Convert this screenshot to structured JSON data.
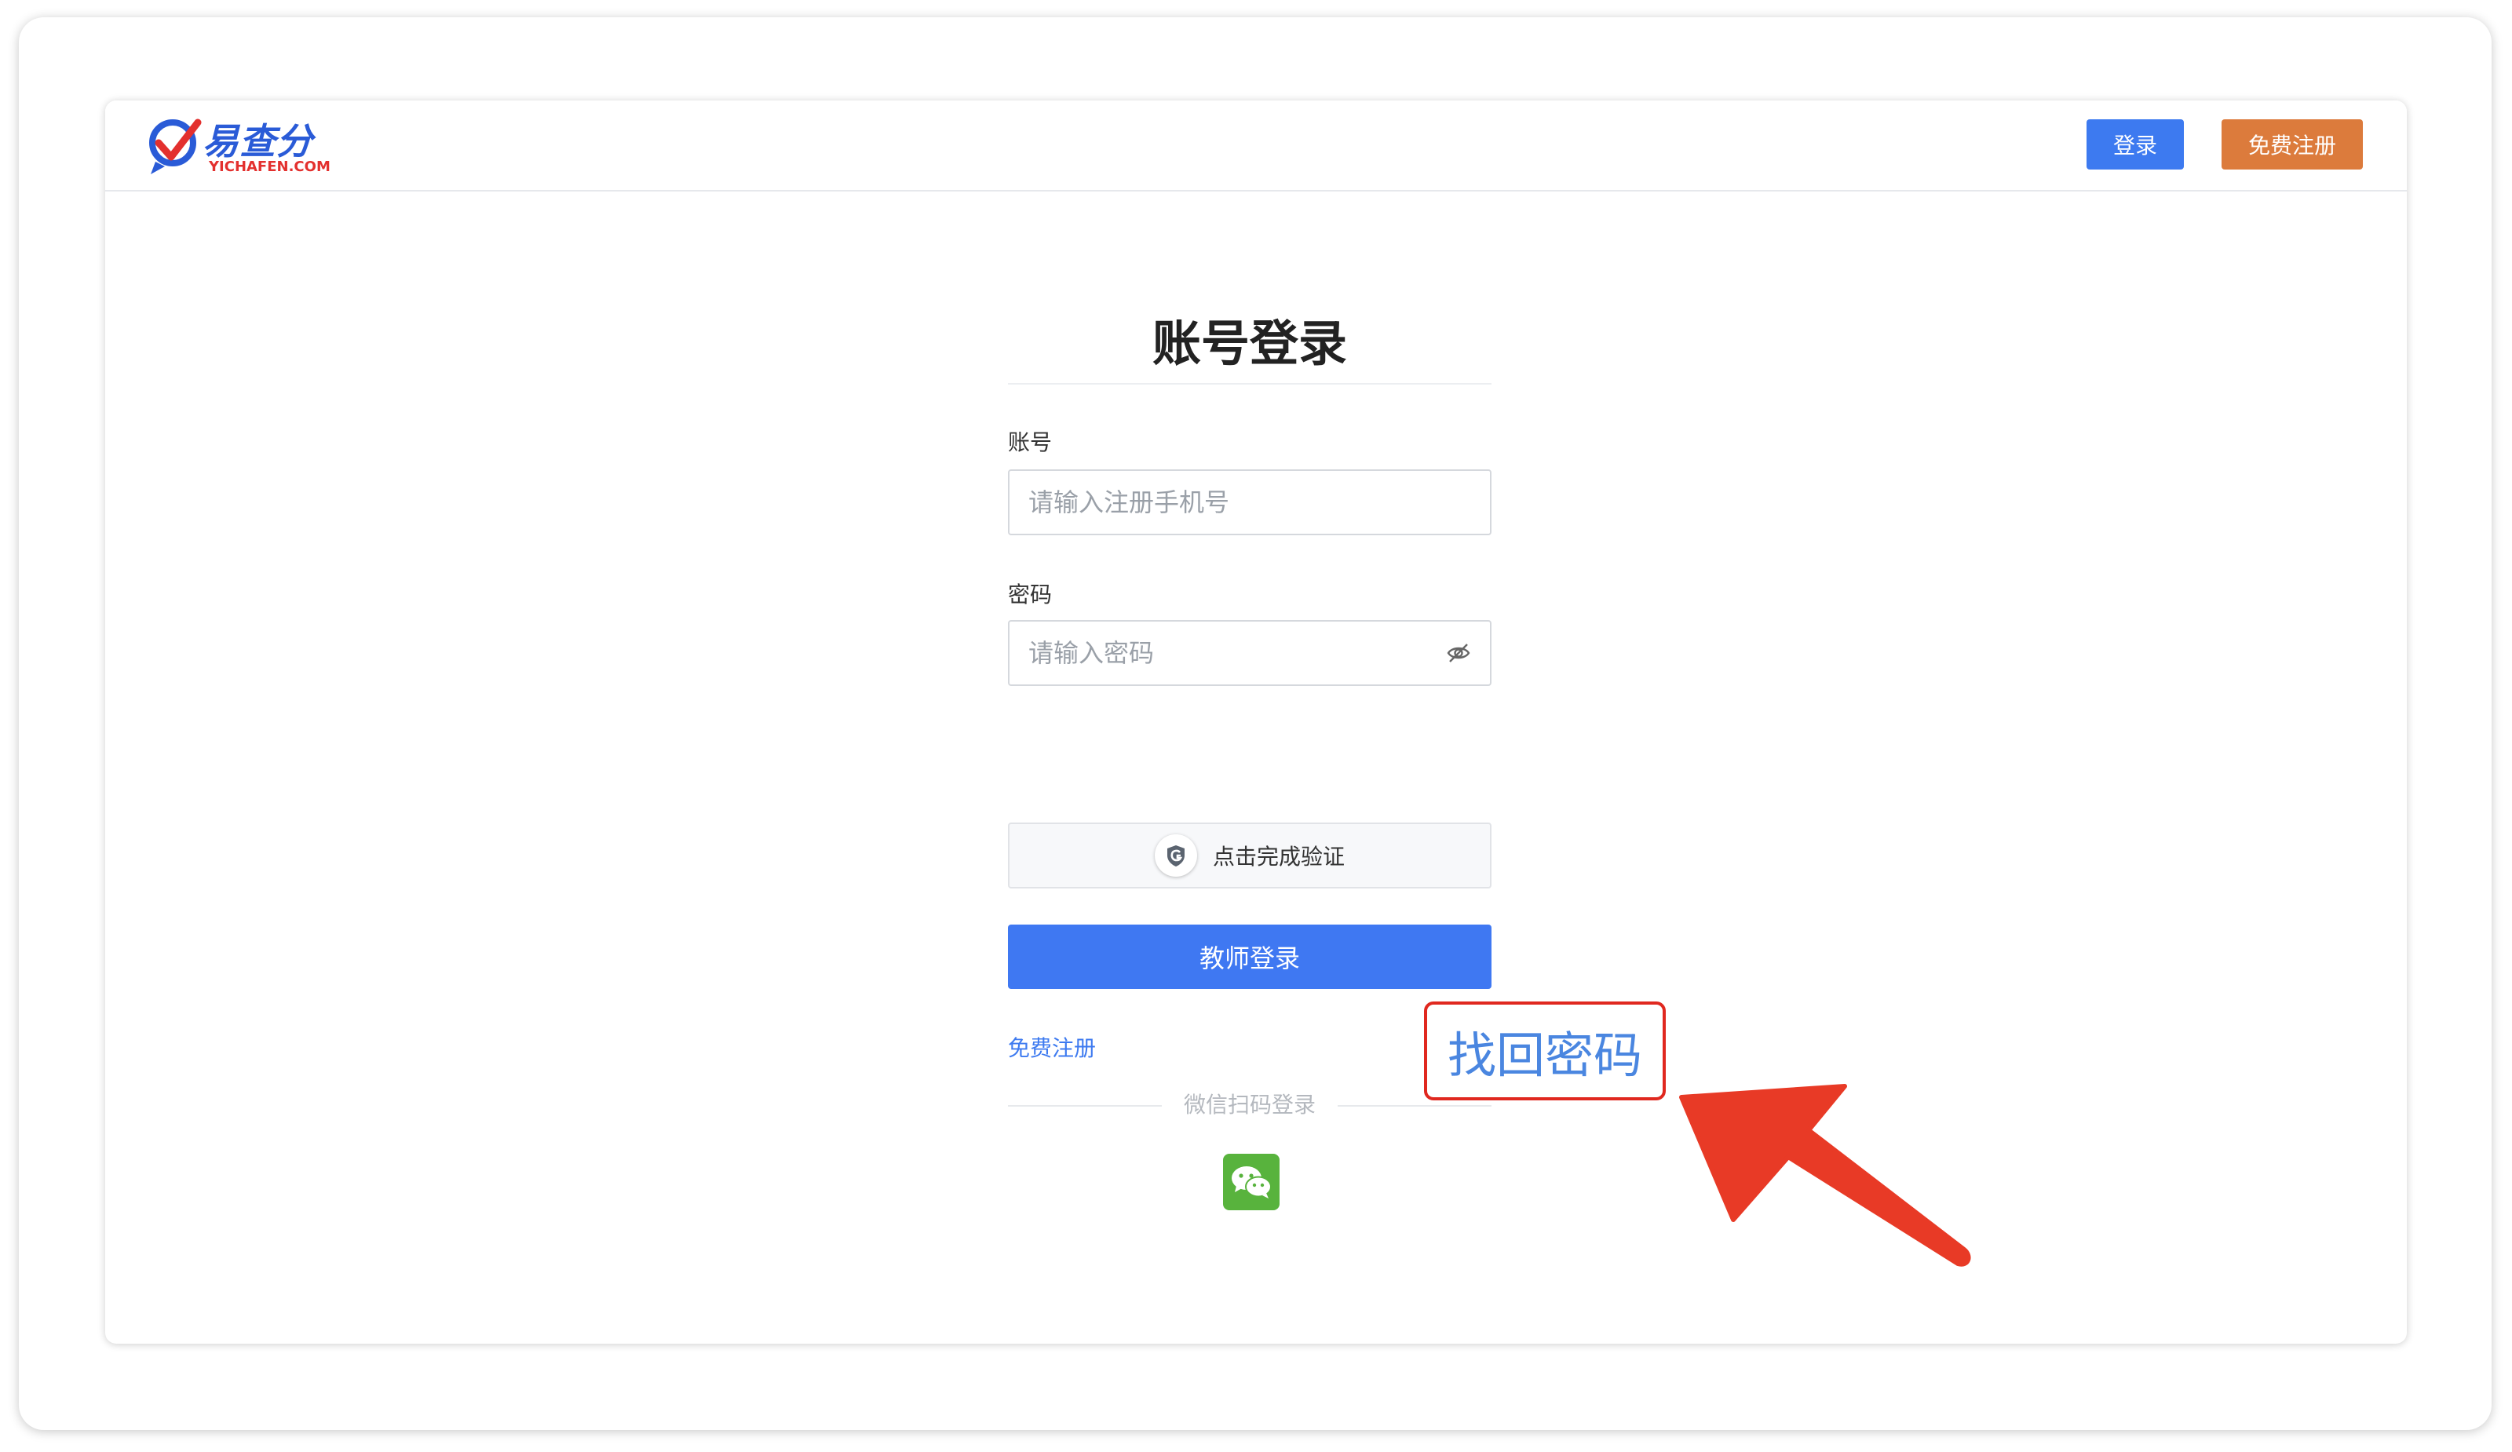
{
  "header": {
    "logo_name": "易查分",
    "logo_domain": "YICHAFEN.COM",
    "login_label": "登录",
    "register_label": "免费注册"
  },
  "form": {
    "title": "账号登录",
    "account_label": "账号",
    "account_placeholder": "请输入注册手机号",
    "password_label": "密码",
    "password_placeholder": "请输入密码",
    "captcha_text": "点击完成验证",
    "submit_label": "教师登录",
    "free_register_link": "免费注册",
    "wechat_divider_text": "微信扫码登录"
  },
  "annotation": {
    "highlight_text": "找回密码",
    "color": "#e0281f",
    "arrow_color": "#e83a26"
  },
  "icons": {
    "eye": "eye-off-icon",
    "captcha": "shield-icon",
    "wechat": "wechat-icon"
  },
  "colors": {
    "primary": "#3d7af0",
    "accent": "#dc7b3c",
    "wechat": "#58b33d"
  }
}
